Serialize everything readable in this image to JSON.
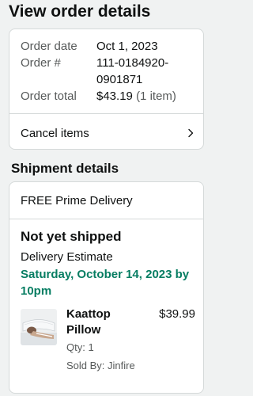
{
  "page": {
    "title": "View order details"
  },
  "order": {
    "date_label": "Order date",
    "date_value": "Oct 1, 2023",
    "number_label": "Order #",
    "number_line1": "111-0184920-",
    "number_line2": "0901871",
    "total_label": "Order total",
    "total_value": "$43.19",
    "total_items": "(1 item)",
    "cancel_label": "Cancel items"
  },
  "shipment": {
    "section_title": "Shipment details",
    "delivery_type": "FREE Prime Delivery",
    "status": "Not yet shipped",
    "estimate_label": "Delivery Estimate",
    "estimate_date": "Saturday, October 14, 2023 by 10pm",
    "item": {
      "name": "Kaattop Pillow",
      "price": "$39.99",
      "qty": "Qty: 1",
      "seller": "Sold By: Jinfire"
    }
  },
  "colors": {
    "accent_green": "#067d62",
    "muted_text": "#565959",
    "border": "#d5d9d9"
  }
}
